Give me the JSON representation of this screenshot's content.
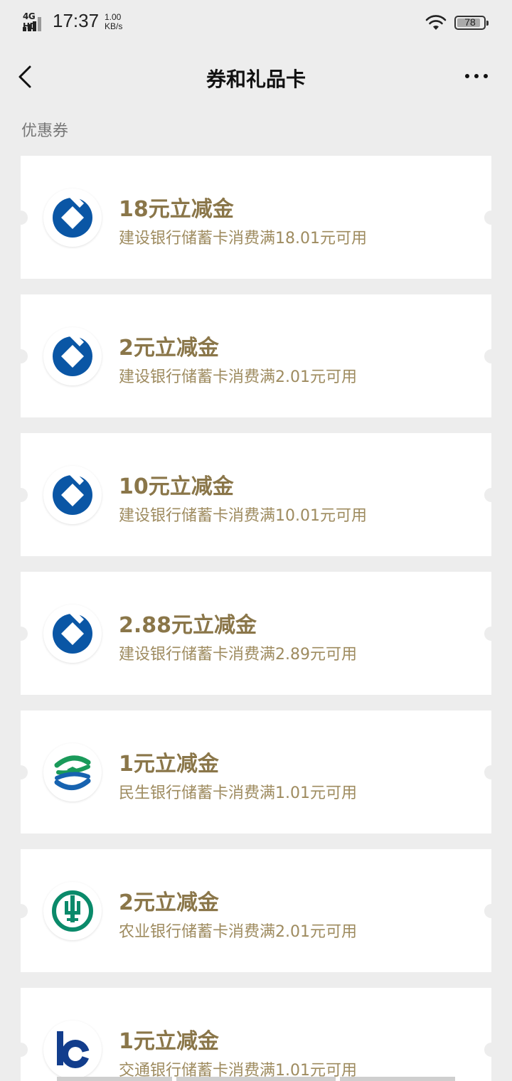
{
  "status_bar": {
    "network": "4G HD",
    "time": "17:37",
    "speed_value": "1.00",
    "speed_unit": "KB/s",
    "battery": "78"
  },
  "nav": {
    "title": "券和礼品卡",
    "back_icon": "chevron-left-icon",
    "more_icon": "more-icon"
  },
  "section": {
    "title": "优惠券"
  },
  "coupons": [
    {
      "amount": "18元立减金",
      "condition": "建设银行储蓄卡消费满18.01元可用",
      "bank": "ccb"
    },
    {
      "amount": "2元立减金",
      "condition": "建设银行储蓄卡消费满2.01元可用",
      "bank": "ccb"
    },
    {
      "amount": "10元立减金",
      "condition": "建设银行储蓄卡消费满10.01元可用",
      "bank": "ccb"
    },
    {
      "amount": "2.88元立减金",
      "condition": "建设银行储蓄卡消费满2.89元可用",
      "bank": "ccb"
    },
    {
      "amount": "1元立减金",
      "condition": "民生银行储蓄卡消费满1.01元可用",
      "bank": "cmbc"
    },
    {
      "amount": "2元立减金",
      "condition": "农业银行储蓄卡消费满2.01元可用",
      "bank": "abc"
    },
    {
      "amount": "1元立减金",
      "condition": "交通银行储蓄卡消费满1.01元可用",
      "bank": "bocom"
    }
  ],
  "colors": {
    "ccb": "#0a56a5",
    "cmbc_green": "#1a9a5a",
    "cmbc_blue": "#1763b0",
    "abc": "#0a8a6a",
    "bocom": "#123d8c",
    "amount_text": "#8a7649"
  }
}
